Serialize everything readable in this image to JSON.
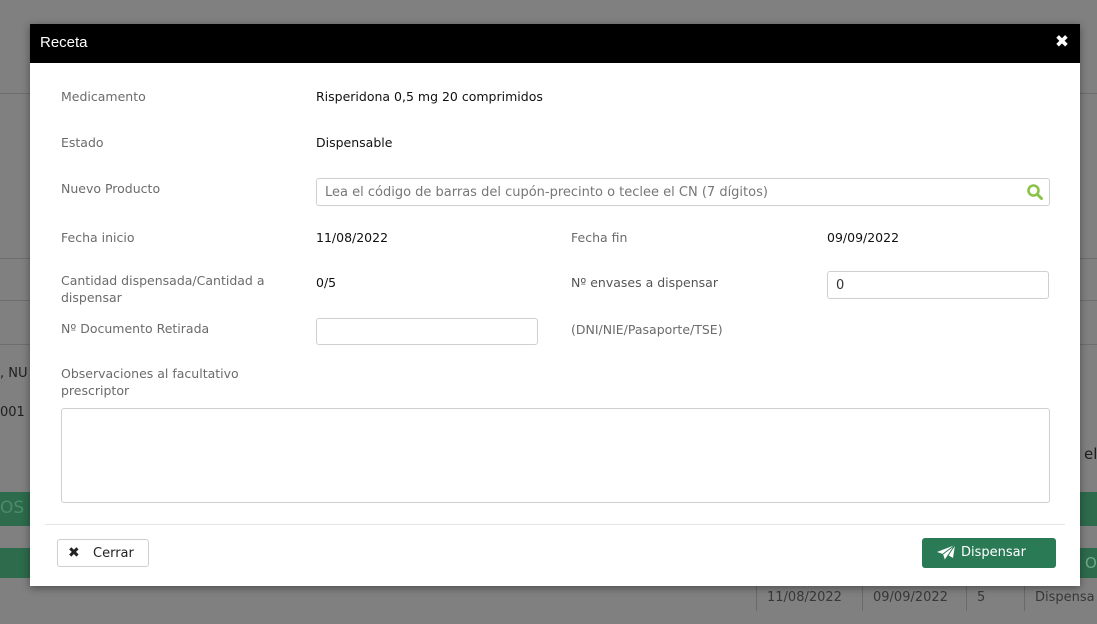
{
  "background": {
    "fragment_left_1": ", NU",
    "fragment_left_2": "001",
    "fragment_right_1": "el",
    "fragment_band_left": "OS",
    "fragment_band_right": "O",
    "row": [
      "11/08/2022",
      "09/09/2022",
      "5",
      "Dispensa"
    ]
  },
  "modal": {
    "title": "Receta",
    "close_icon": "close-icon",
    "fields": {
      "medicamento_label": "Medicamento",
      "medicamento_value": "Risperidona 0,5 mg 20 comprimidos",
      "estado_label": "Estado",
      "estado_value": "Dispensable",
      "nuevo_producto_label": "Nuevo Producto",
      "nuevo_producto_placeholder": "Lea el código de barras del cupón-precinto o teclee el CN (7 dígitos)",
      "nuevo_producto_value": "",
      "fecha_inicio_label": "Fecha inicio",
      "fecha_inicio_value": "11/08/2022",
      "fecha_fin_label": "Fecha fin",
      "fecha_fin_value": "09/09/2022",
      "cantidad_label": "Cantidad dispensada/Cantidad a dispensar",
      "cantidad_value": "0/5",
      "envases_label": "Nº envases a dispensar",
      "envases_value": "0",
      "documento_label": "Nº Documento Retirada",
      "documento_value": "",
      "documento_hint": "(DNI/NIE/Pasaporte/TSE)",
      "observaciones_label": "Observaciones al facultativo prescriptor",
      "observaciones_value": ""
    },
    "footer": {
      "cerrar_label": "Cerrar",
      "dispensar_label": "Dispensar"
    }
  },
  "colors": {
    "header_bg": "#000000",
    "accent": "#2a7a55",
    "search_icon": "#8bc34a"
  }
}
